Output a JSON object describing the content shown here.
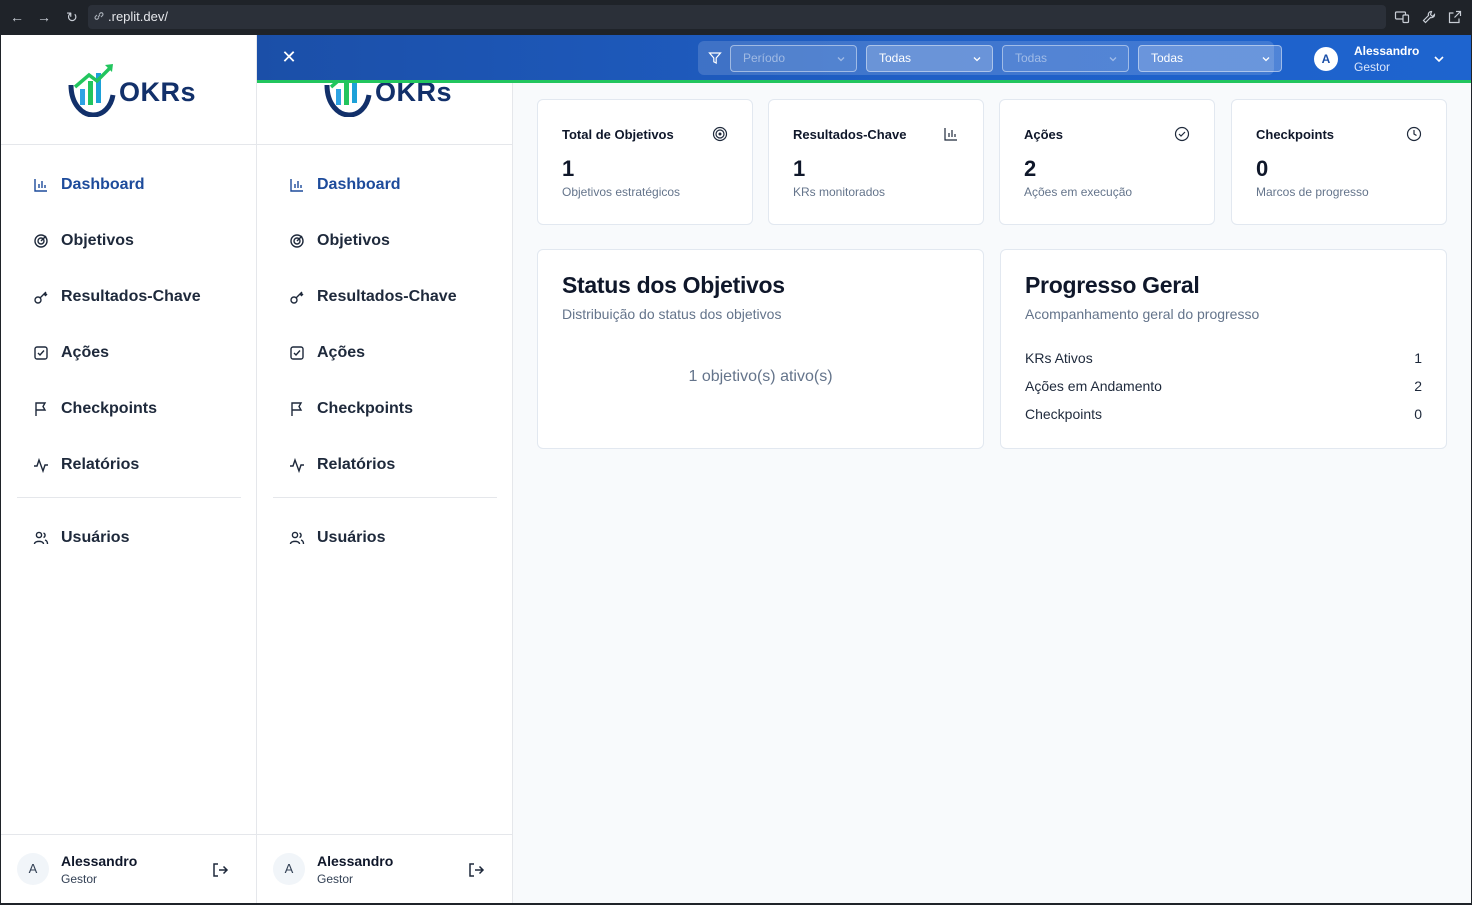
{
  "browser": {
    "url": ".replit.dev/"
  },
  "app": {
    "logo_text": "OKRs"
  },
  "sidebar": {
    "items": [
      {
        "label": "Dashboard",
        "icon": "bar-chart-icon"
      },
      {
        "label": "Objetivos",
        "icon": "target-icon"
      },
      {
        "label": "Resultados-Chave",
        "icon": "key-icon"
      },
      {
        "label": "Ações",
        "icon": "check-square-icon"
      },
      {
        "label": "Checkpoints",
        "icon": "flag-icon"
      },
      {
        "label": "Relatórios",
        "icon": "activity-icon"
      }
    ],
    "admin_items": [
      {
        "label": "Usuários",
        "icon": "users-icon"
      }
    ],
    "user": {
      "initial": "A",
      "name": "Alessandro",
      "role": "Gestor"
    }
  },
  "topbar": {
    "filters": [
      {
        "label": "Período",
        "state": "disabled"
      },
      {
        "label": "Todas",
        "state": "enabled"
      },
      {
        "label": "Todas",
        "state": "disabled"
      },
      {
        "label": "Todas",
        "state": "enabled"
      }
    ],
    "user": {
      "initial": "A",
      "name": "Alessandro",
      "role": "Gestor"
    }
  },
  "stats": [
    {
      "title": "Total de Objetivos",
      "value": "1",
      "subtitle": "Objetivos estratégicos",
      "icon": "target-icon"
    },
    {
      "title": "Resultados-Chave",
      "value": "1",
      "subtitle": "KRs monitorados",
      "icon": "bar-chart-icon"
    },
    {
      "title": "Ações",
      "value": "2",
      "subtitle": "Ações em execução",
      "icon": "check-circle-icon"
    },
    {
      "title": "Checkpoints",
      "value": "0",
      "subtitle": "Marcos de progresso",
      "icon": "clock-icon"
    }
  ],
  "status_card": {
    "title": "Status dos Objetivos",
    "subtitle": "Distribuição do status dos objetivos",
    "message": "1 objetivo(s) ativo(s)"
  },
  "progress_card": {
    "title": "Progresso Geral",
    "subtitle": "Acompanhamento geral do progresso",
    "rows": [
      {
        "label": "KRs Ativos",
        "value": "1"
      },
      {
        "label": "Ações em Andamento",
        "value": "2"
      },
      {
        "label": "Checkpoints",
        "value": "0"
      }
    ]
  },
  "colors": {
    "brand_blue": "#1b4fa8",
    "accent_green": "#22c55e",
    "active_nav": "#1d4b9b"
  }
}
